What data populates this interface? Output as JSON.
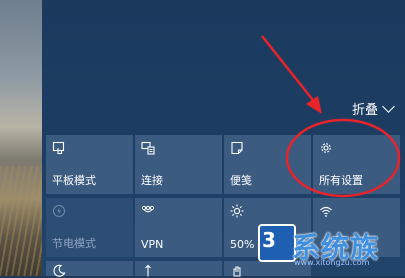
{
  "panel": {
    "collapse_label": "折叠"
  },
  "tiles": [
    {
      "label": "平板模式",
      "icon": "tablet-mode-icon"
    },
    {
      "label": "连接",
      "icon": "connect-icon"
    },
    {
      "label": "便笺",
      "icon": "note-icon"
    },
    {
      "label": "所有设置",
      "icon": "gear-icon"
    },
    {
      "label": "节电模式",
      "icon": "battery-saver-icon"
    },
    {
      "label": "VPN",
      "icon": "vpn-icon"
    },
    {
      "label": "50%",
      "icon": "brightness-icon"
    },
    {
      "label": "",
      "icon": "wifi-icon"
    }
  ],
  "watermark": {
    "number": "3",
    "text": "系统族",
    "url": "www.xitongzu.com"
  },
  "colors": {
    "tile": "#3b5b80",
    "panel": "#1d3d63",
    "annotation": "#e8232a"
  }
}
